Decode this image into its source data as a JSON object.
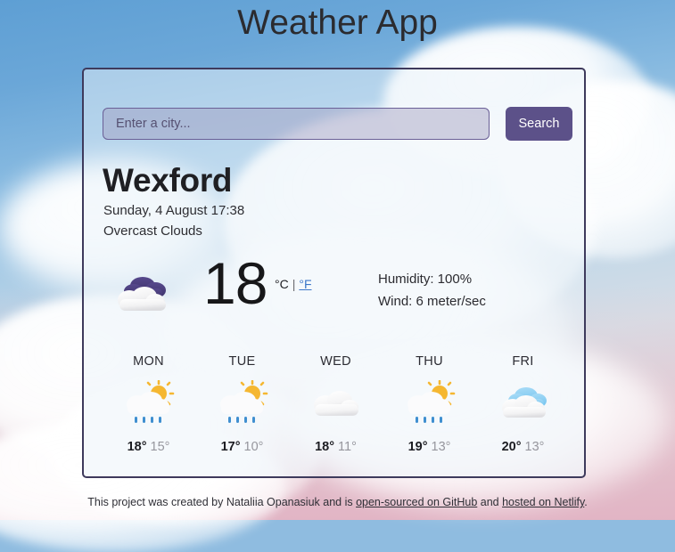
{
  "app": {
    "title": "Weather App"
  },
  "search": {
    "placeholder": "Enter a city...",
    "value": "",
    "button_label": "Search"
  },
  "current": {
    "city": "Wexford",
    "datetime": "Sunday, 4 August 17:38",
    "condition": "Overcast Clouds",
    "icon": "overcast-clouds-icon",
    "temperature": "18",
    "unit_celsius_label": "°C",
    "unit_separator": "|",
    "unit_fahrenheit_label": "°F",
    "active_unit": "celsius",
    "humidity": "Humidity: 100%",
    "wind": "Wind: 6 meter/sec"
  },
  "forecast": [
    {
      "day": "MON",
      "icon": "sun-behind-rain-cloud-icon",
      "max": "18°",
      "min": "15°"
    },
    {
      "day": "TUE",
      "icon": "sun-behind-rain-cloud-icon",
      "max": "17°",
      "min": "10°"
    },
    {
      "day": "WED",
      "icon": "cloud-icon",
      "max": "18°",
      "min": "11°"
    },
    {
      "day": "THU",
      "icon": "sun-behind-rain-cloud-icon",
      "max": "19°",
      "min": "13°"
    },
    {
      "day": "FRI",
      "icon": "broken-clouds-icon",
      "max": "20°",
      "min": "13°"
    }
  ],
  "footer": {
    "text_before": "This project was created by Nataliia Opanasiuk and is ",
    "link_github": "open-sourced on GitHub",
    "text_middle": " and ",
    "link_netlify": "hosted on Netlify",
    "text_after": "."
  },
  "colors": {
    "accent_purple": "#5c5189",
    "card_border": "#3e3a5c",
    "link_blue": "#3d77c9",
    "text_dark": "#1f1f23",
    "text_muted": "#96969d",
    "sun_yellow": "#f5b731",
    "rain_blue": "#3f8fd0",
    "cloud_dark": "#4a3f78"
  }
}
